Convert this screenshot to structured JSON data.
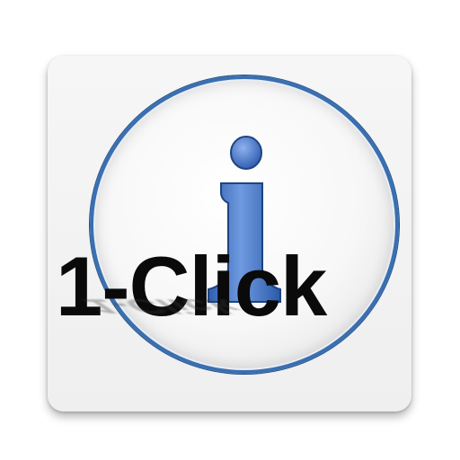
{
  "icon": {
    "name": "info-icon",
    "caption": "1-Click",
    "colors": {
      "tile_background": "#f2f2f2",
      "ring": "#3a6fb0",
      "glyph": "#3d6fc4",
      "caption": "#0a0a0a"
    }
  }
}
